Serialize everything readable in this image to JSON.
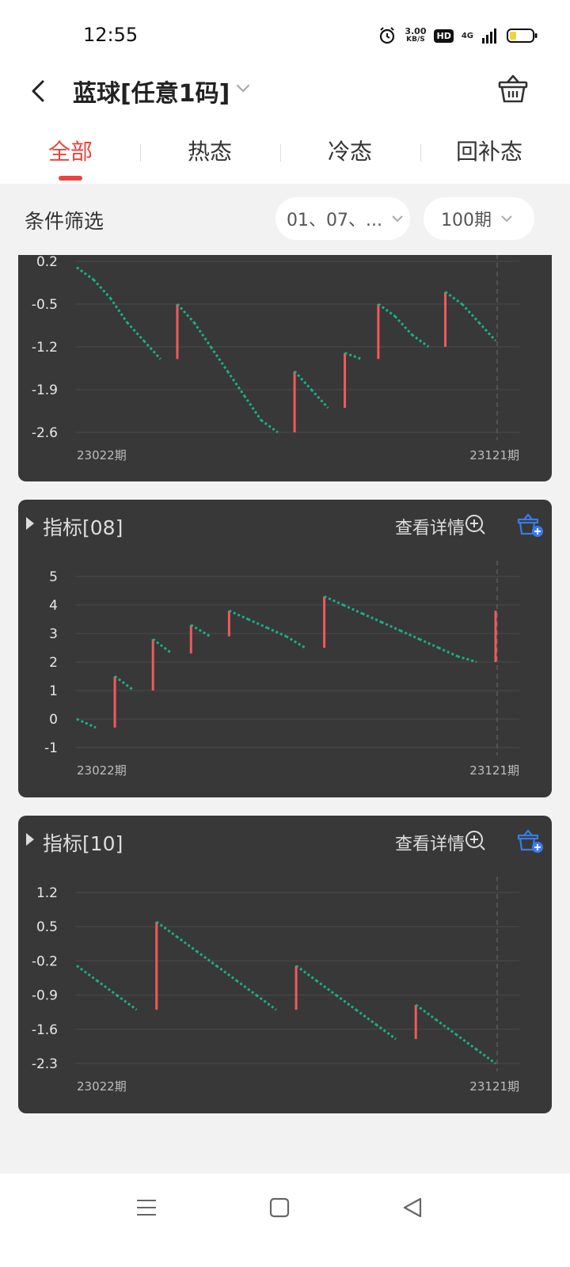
{
  "status": {
    "time": "12:55",
    "speed_value": "3.00",
    "speed_unit": "KB/S",
    "hd": "HD",
    "network": "4G"
  },
  "header": {
    "title": "蓝球[任意1码]",
    "back_icon": "back-chevron-icon",
    "basket_icon": "basket-icon"
  },
  "tabs": [
    {
      "label": "全部",
      "active": true
    },
    {
      "label": "热态",
      "active": false
    },
    {
      "label": "冷态",
      "active": false
    },
    {
      "label": "回补态",
      "active": false
    }
  ],
  "filter": {
    "label": "条件筛选",
    "numbers_value": "01、07、...",
    "periods_value": "100期"
  },
  "colors": {
    "accent": "#e8453c",
    "card_bg": "#383838",
    "series_down": "#19b088",
    "series_up": "#f05a5a",
    "cart_blue": "#3a7be8"
  },
  "charts": [
    {
      "partial": true,
      "chart_data": {
        "type": "line",
        "y_ticks": [
          "0.2",
          "-0.5",
          "-1.2",
          "-1.9",
          "-2.6"
        ],
        "ylim": [
          -2.6,
          0.2
        ],
        "x_start_label": "23022期",
        "x_end_label": "23121期",
        "values": [
          0.1,
          -0.1,
          -0.4,
          -0.8,
          -1.1,
          -1.4,
          -0.5,
          -0.8,
          -1.2,
          -1.6,
          -2.0,
          -2.4,
          -2.6,
          -1.6,
          -1.9,
          -2.2,
          -1.3,
          -1.4,
          -0.5,
          -0.7,
          -1.0,
          -1.2,
          -0.3,
          -0.5,
          -0.8,
          -1.1
        ]
      }
    },
    {
      "title": "指标[08]",
      "detail_label": "查看详情",
      "chart_data": {
        "type": "line",
        "y_ticks": [
          "5",
          "4",
          "3",
          "2",
          "1",
          "0",
          "-1"
        ],
        "ylim": [
          -1,
          5
        ],
        "x_start_label": "23022期",
        "x_end_label": "23121期",
        "values": [
          0,
          -0.3,
          1.5,
          1,
          2.8,
          2.3,
          3.3,
          2.9,
          3.8,
          3.5,
          3.2,
          2.9,
          2.5,
          4.3,
          4.0,
          3.7,
          3.4,
          3.1,
          2.8,
          2.5,
          2.2,
          2.0,
          3.8
        ]
      }
    },
    {
      "title": "指标[10]",
      "detail_label": "查看详情",
      "chart_data": {
        "type": "line",
        "y_ticks": [
          "1.2",
          "0.5",
          "-0.2",
          "-0.9",
          "-1.6",
          "-2.3"
        ],
        "ylim": [
          -2.3,
          1.2
        ],
        "x_start_label": "23022期",
        "x_end_label": "23121期",
        "values": [
          -0.3,
          -0.6,
          -0.9,
          -1.2,
          0.6,
          0.3,
          0.0,
          -0.3,
          -0.6,
          -0.9,
          -1.2,
          -0.3,
          -0.6,
          -0.9,
          -1.2,
          -1.5,
          -1.8,
          -1.1,
          -1.4,
          -1.7,
          -2.0,
          -2.3
        ]
      }
    }
  ],
  "nav": {
    "menu_icon": "menu-icon",
    "home_icon": "home-square-icon",
    "back_icon": "back-triangle-icon"
  }
}
